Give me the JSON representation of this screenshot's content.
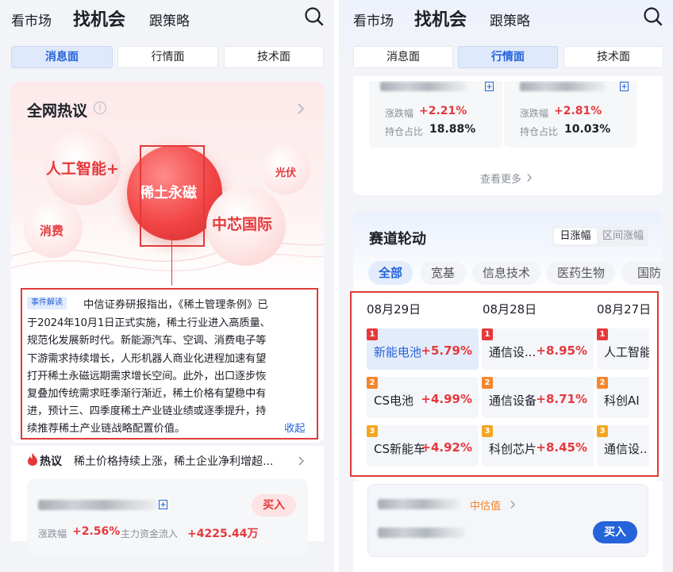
{
  "nav": {
    "market": "看市场",
    "opportunity": "找机会",
    "strategy": "跟策略"
  },
  "tabs": [
    "消息面",
    "行情面",
    "技术面"
  ],
  "left": {
    "hot_title": "全网热议",
    "info_icon": "i",
    "bubbles": [
      "人工智能+",
      "稀土永磁",
      "光伏",
      "消费",
      "中芯国际"
    ],
    "event_tag": "事件解读",
    "event_lines": [
      "中信证券研报指出，《稀土管理条例》已",
      "于2024年10月1日正式实施，稀土行业进入高质量、",
      "规范化发展新时代。新能源汽车、空调、消费电子等",
      "下游需求持续增长，人形机器人商业化进程加速有望",
      "打开稀土永磁远期需求增长空间。此外，出口逐步恢",
      "复叠加传统需求旺季渐行渐近，稀土价格有望稳中有",
      "进，预计三、四季度稀土产业链业绩或逐季提升，持",
      "续推荐稀土产业链战略配置价值。"
    ],
    "collapse": "收起",
    "hot_label": "热议",
    "hot_text": "稀土价格持续上涨，稀土企业净利增超...",
    "stock": {
      "buy": "买入",
      "change_label": "涨跌幅",
      "change_value": "+2.56%",
      "flow_label": "主力资金流入",
      "flow_value": "+4225.44万"
    }
  },
  "right": {
    "funds": [
      {
        "change_label": "涨跌幅",
        "change_value": "+2.21%",
        "hold_label": "持仓占比",
        "hold_value": "18.88%"
      },
      {
        "change_label": "涨跌幅",
        "change_value": "+2.81%",
        "hold_label": "持仓占比",
        "hold_value": "10.03%"
      }
    ],
    "see_more": "查看更多",
    "rotation": {
      "title": "赛道轮动",
      "toggle": [
        "日涨幅",
        "区间涨幅"
      ],
      "chips": [
        "全部",
        "宽基",
        "信息技术",
        "医药生物",
        "国防"
      ],
      "dates": [
        "08月29日",
        "08月28日",
        "08月27日"
      ],
      "columns": [
        [
          {
            "rank": "1",
            "name": "新能电池",
            "value": "+5.79%"
          },
          {
            "rank": "2",
            "name": "CS电池",
            "value": "+4.99%"
          },
          {
            "rank": "3",
            "name": "CS新能车",
            "value": "+4.92%"
          }
        ],
        [
          {
            "rank": "1",
            "name": "通信设...",
            "value": "+8.95%"
          },
          {
            "rank": "2",
            "name": "通信设备",
            "value": "+8.71%"
          },
          {
            "rank": "3",
            "name": "科创芯片",
            "value": "+8.45%"
          }
        ],
        [
          {
            "rank": "1",
            "name": "人工智能",
            "value": ""
          },
          {
            "rank": "2",
            "name": "科创AI",
            "value": ""
          },
          {
            "rank": "3",
            "name": "通信设..",
            "value": ""
          }
        ]
      ]
    },
    "fund_bottom": {
      "valuation": "中估值",
      "buy": "买入"
    }
  },
  "colors": {
    "accent_red": "#e4393c",
    "accent_blue": "#2463d9",
    "highlight_border": "#e03a3a"
  }
}
